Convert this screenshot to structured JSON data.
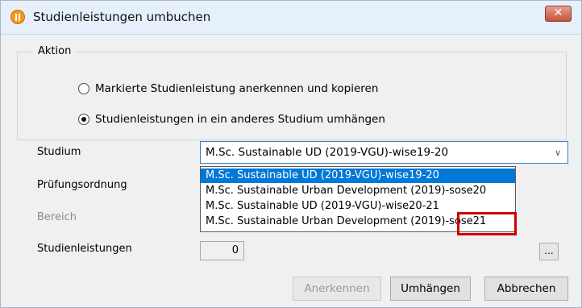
{
  "window": {
    "title": "Studienleistungen umbuchen",
    "close_label": "✕"
  },
  "aktion": {
    "legend": "Aktion",
    "options": [
      {
        "label": "Markierte Studienleistung anerkennen und kopieren",
        "checked": false
      },
      {
        "label": "Studienleistungen in ein anderes Studium umhängen",
        "checked": true
      }
    ]
  },
  "form": {
    "studium_label": "Studium",
    "studium_value": "M.Sc. Sustainable UD (2019-VGU)-wise19-20",
    "pruefungsordnung_label": "Prüfungsordnung",
    "bereich_label": "Bereich",
    "studienleistungen_label": "Studienleistungen",
    "studienleistungen_value": "0",
    "ellipsis_label": "..."
  },
  "dropdown": {
    "items": [
      {
        "label": "M.Sc. Sustainable UD (2019-VGU)-wise19-20",
        "selected": true
      },
      {
        "label": "M.Sc. Sustainable Urban Development (2019)-sose20",
        "selected": false
      },
      {
        "label": "M.Sc. Sustainable UD (2019-VGU)-wise20-21",
        "selected": false
      },
      {
        "label": "M.Sc. Sustainable Urban Development (2019)-sose21",
        "selected": false
      }
    ]
  },
  "buttons": {
    "anerkennen": "Anerkennen",
    "umhaengen": "Umhängen",
    "abbrechen": "Abbrechen"
  },
  "colors": {
    "selection": "#0078d7",
    "highlight": "#cc0000"
  }
}
